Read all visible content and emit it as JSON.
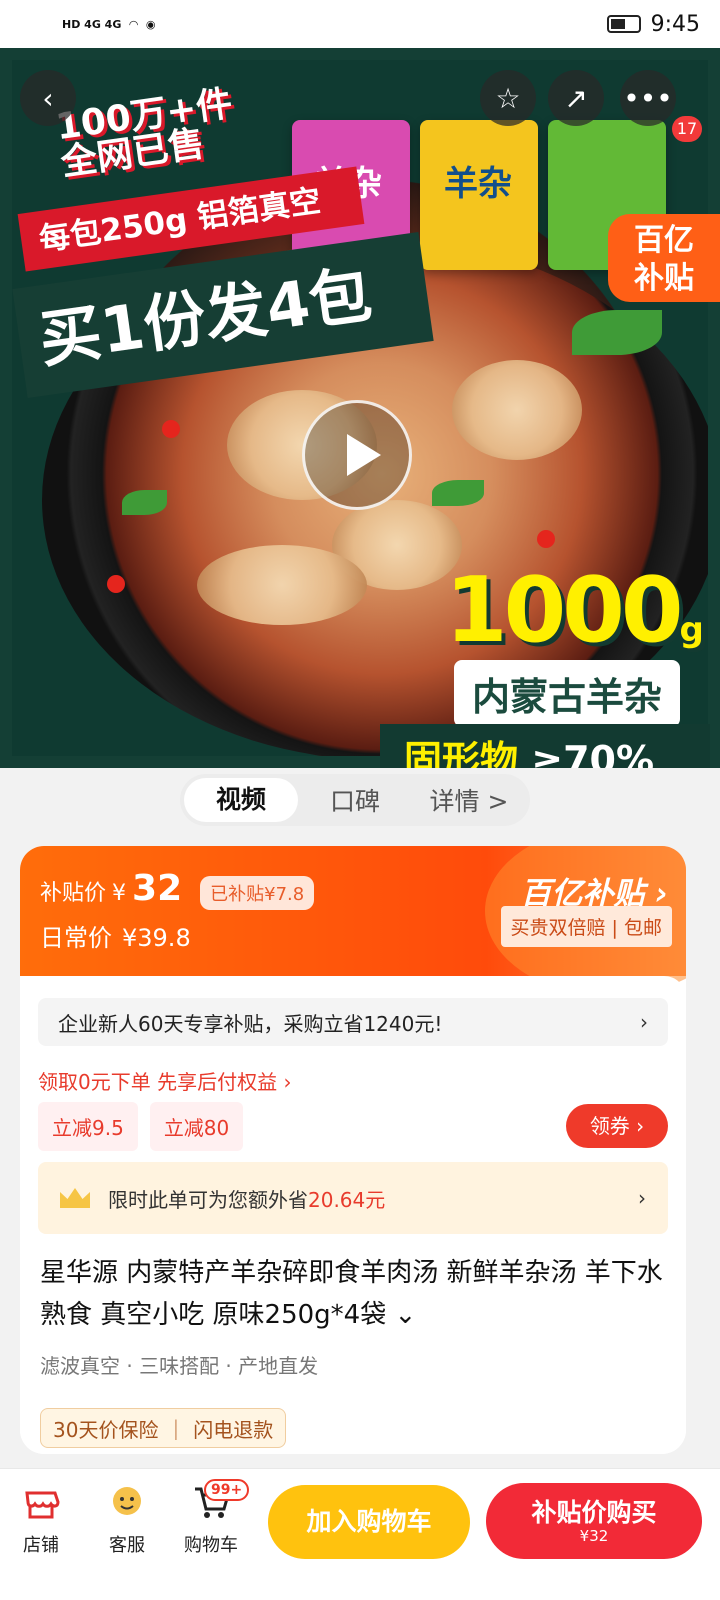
{
  "status": {
    "time": "9:45",
    "signal_text": "HD 4G 4G"
  },
  "hero": {
    "sales_line1": "100万+件",
    "sales_line2": "全网已售",
    "package_spec": "每包250g 铝箔真空",
    "promo": "买1份发4包",
    "weight": "1000",
    "weight_unit": "g",
    "tagline": "内蒙古羊杂",
    "solid_prefix": "固形物",
    "solid_value": "≥70%",
    "pkg_label": "羊杂",
    "subsidy_logo_1": "百亿",
    "subsidy_logo_2": "补贴",
    "cart_badge": "17"
  },
  "tabs": [
    "视频",
    "口碑",
    "详情 >"
  ],
  "price": {
    "subsidy_label": "补贴价",
    "currency": "¥",
    "subsidy_price": "32",
    "subsidized_amount": "已补贴¥7.8",
    "daily_label": "日常价",
    "daily_price": "¥39.8",
    "program_label": "百亿补贴",
    "program_sub": "买贵双倍赔 | 包邮"
  },
  "offers": {
    "newbiz": "企业新人60天专享补贴，采购立省1240元!",
    "firstorder": "领取0元下单 先享后付权益 ›",
    "coupon1": "立减9.5",
    "coupon2": "立减80",
    "get_coupon": "领券",
    "saver_prefix": "限时此单可为您额外省",
    "saver_value": "20.64元"
  },
  "product": {
    "title": "星华源 内蒙特产羊杂碎即食羊肉汤 新鲜羊杂汤 羊下水熟食 真空小吃 原味250g*4袋",
    "features": "滤波真空 · 三味搭配 · 产地直发",
    "guarantee1": "30天价保险",
    "guarantee2": "闪电退款"
  },
  "bottom": {
    "store": "店铺",
    "service": "客服",
    "cart": "购物车",
    "cart_count": "99+",
    "add_to_cart": "加入购物车",
    "buy_now": "补贴价购买",
    "buy_price": "¥32"
  },
  "colors": {
    "orange": "#ff5a0a",
    "red": "#ef3a2a",
    "yellow": "#ffc20e",
    "green": "#143f35"
  }
}
